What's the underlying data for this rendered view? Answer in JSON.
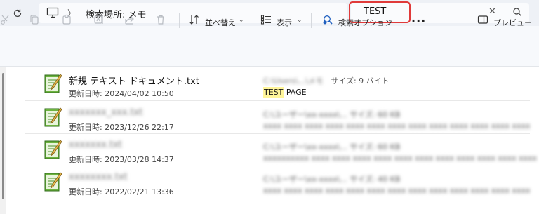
{
  "address_bar": {
    "breadcrumb": "検索場所: メモ",
    "search_value": "TEST"
  },
  "toolbar": {
    "sort_label": "並べ替え",
    "view_label": "表示",
    "search_options_label": "検索オプション",
    "preview_label": "プレビュー"
  },
  "results": [
    {
      "name": "新規 テキスト ドキュメント.txt",
      "date": "更新日時: 2024/04/02 10:50",
      "meta1_blur": "C:\\Users\\...\\メモ",
      "meta1_clear": "サイズ: 9 バイト",
      "match_highlight": "TEST",
      "match_rest": " PAGE"
    },
    {
      "name": "xxxxxxx_xxx.txt",
      "date": "更新日時: 2023/12/26 22:17",
      "meta1_blur": "C:\\ユーザー\\xx-xxxx\\...   サイズ: 60 KB",
      "meta2_blur": "xxxx xxxx xxxx xxxx xxxx xxxx xxxx xxxx xxxx xxxx xxxx xxxx xxxx"
    },
    {
      "name": "xxxxxxx.txt",
      "date": "更新日時: 2023/03/28 14:37",
      "meta1_blur": "C:\\ユーザー\\xx-xxxx\\...   サイズ: 60 KB",
      "meta2_blur": "xxxxxxxxxx xxxx xxxx xxxx xxxx xxxx xxxx xxxx xxxx xxxx xxxx xxxx"
    },
    {
      "name": "xxxxxxxx.txt",
      "date": "更新日時: 2022/02/21 13:36",
      "meta1_blur": "C:\\ユーザー\\xx-xxxx\\...   サイズ: 40 KB",
      "meta2_blur": "xxxx xxxx xxxx xxxx xxxx xxxx xxxx xxxx xxxx xxxx xxxx xxxx xxxx"
    }
  ],
  "colors": {
    "highlight_border": "#e03a3a",
    "match_highlight": "#fff59a"
  }
}
